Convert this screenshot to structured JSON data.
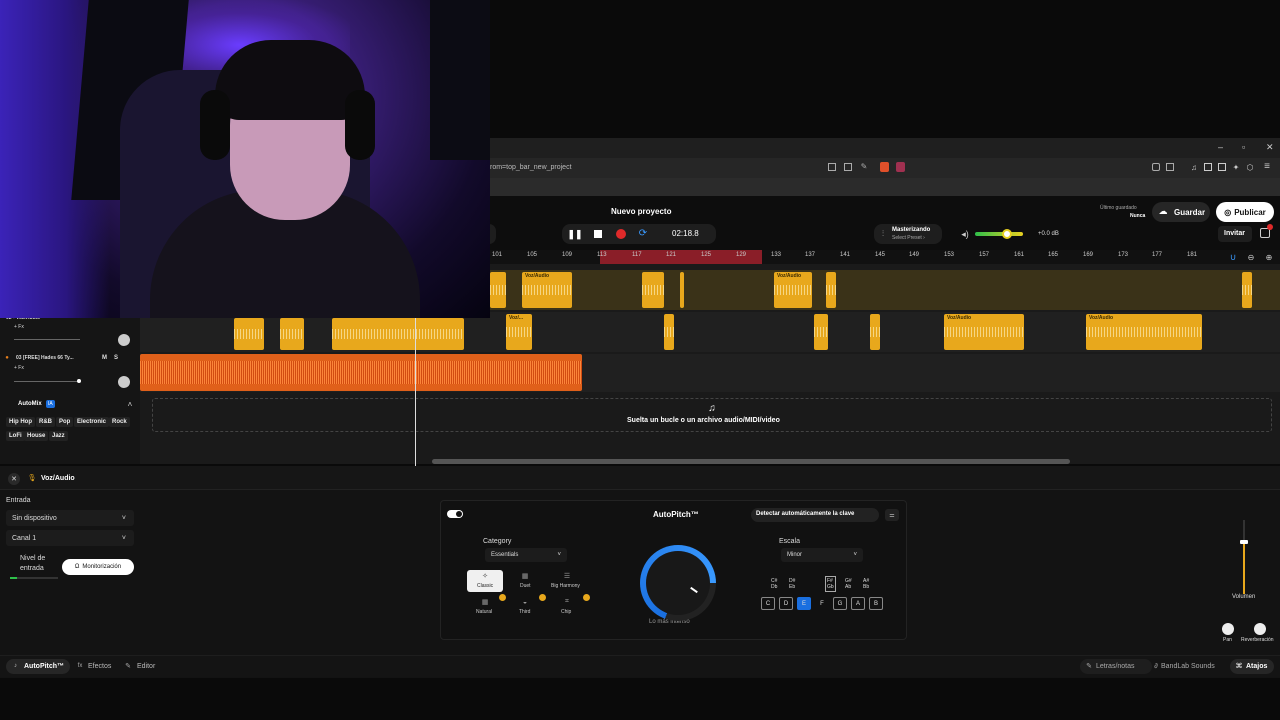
{
  "browser": {
    "url": "rom=top_bar_new_project",
    "window_controls": [
      "–",
      "▫",
      "✕"
    ]
  },
  "header": {
    "project_title": "Nuevo proyecto",
    "time": "02:18.8",
    "mastering_title": "Masterizando",
    "mastering_sub": "Select Preset ›",
    "volume_db": "+0.0 dB",
    "last_saved_label": "Último guardado",
    "last_saved_value": "Nunca",
    "save_label": "Guardar",
    "publish_label": "Publicar",
    "invite_label": "Invitar"
  },
  "ruler": {
    "ticks": [
      "101",
      "105",
      "109",
      "113",
      "117",
      "121",
      "125",
      "129",
      "133",
      "137",
      "141",
      "145",
      "149",
      "153",
      "157",
      "161",
      "165",
      "169",
      "173",
      "177",
      "181"
    ]
  },
  "tracks": {
    "track1_clip": "Voz/Audio",
    "track1_clip2": "Voz/Audio",
    "track2_name": "02 - Voz/Audio",
    "track2_fx": "+ Fx",
    "track2_clip": "Voz/...",
    "track2_clip2": "Voz/Audio",
    "track2_clip3": "Voz/Audio",
    "track3_name": "03 [FREE] Hades 66 Ty...",
    "track3_fx": "+ Fx",
    "mute": "M",
    "solo": "S"
  },
  "automix": {
    "label": "AutoMix",
    "badge": "IA",
    "genres": [
      "Hip Hop",
      "R&B",
      "Pop",
      "Electronic",
      "Rock",
      "LoFi",
      "House",
      "Jazz"
    ]
  },
  "drop_zone": "Suelta un bucle o un archivo audio/MIDI/video",
  "bottom": {
    "track_title": "Voz/Audio",
    "input_label": "Entrada",
    "device": "Sin dispositivo",
    "channel": "Canal 1",
    "level_label_1": "Nivel de",
    "level_label_2": "entrada",
    "monitor_label": "Monitorización",
    "autopitch_title": "AutoPitch™",
    "detect_key": "Detectar automáticamente la clave",
    "category_label": "Category",
    "category_value": "Essentials",
    "presets": [
      "Classic",
      "Duet",
      "Big Harmony",
      "Natural",
      "Third",
      "Chip"
    ],
    "knob_label": "Lo más intenso",
    "scale_label": "Escala",
    "scale_value": "Minor",
    "keys_top": [
      "C#\nDb",
      "D#\nEb",
      "F#\nGb",
      "G#\nAb",
      "A#\nBb"
    ],
    "keys_bottom": [
      "C",
      "D",
      "E",
      "F",
      "G",
      "A",
      "B"
    ],
    "volume_label": "Volumen",
    "pan_label": "Pan",
    "reverb_label": "Reverberación"
  },
  "footer": {
    "tab_autopitch": "AutoPitch™",
    "tab_effects": "Efectos",
    "tab_editor": "Editor",
    "lyrics": "Letras/notas",
    "sounds": "BandLab Sounds",
    "shortcuts": "Atajos"
  },
  "colors": {
    "accent_blue": "#1a6fe0",
    "clip_yellow": "#e8a81c",
    "clip_orange": "#e0601a",
    "record_red": "#e02a2a"
  }
}
